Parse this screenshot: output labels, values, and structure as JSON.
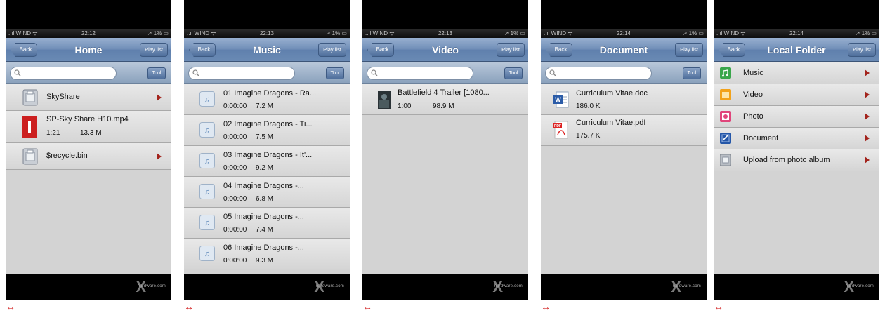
{
  "status": {
    "carrier": "..ıl WIND ᯤ",
    "battery": "↗ 1% ▭"
  },
  "screens": [
    {
      "time": "22:12",
      "title": "Home",
      "back_label": "Back",
      "playlist_label": "Play list",
      "tool_label": "Tool",
      "rows": [
        {
          "name": "SkyShare"
        },
        {
          "name": "SP-Sky Share H10.mp4",
          "duration": "1:21",
          "size": "13.3 M"
        },
        {
          "name": "$recycle.bin"
        }
      ]
    },
    {
      "time": "22:13",
      "title": "Music",
      "back_label": "Back",
      "playlist_label": "Play list",
      "tool_label": "Tool",
      "rows": [
        {
          "name": "01 Imagine Dragons - Ra...",
          "duration": "0:00:00",
          "size": "7.2 M"
        },
        {
          "name": "02 Imagine Dragons - Ti...",
          "duration": "0:00:00",
          "size": "7.5 M"
        },
        {
          "name": "03 Imagine Dragons - It'...",
          "duration": "0:00:00",
          "size": "9.2 M"
        },
        {
          "name": "04 Imagine Dragons -...",
          "duration": "0:00:00",
          "size": "6.8 M"
        },
        {
          "name": "05 Imagine Dragons -...",
          "duration": "0:00:00",
          "size": "7.4 M"
        },
        {
          "name": "06 Imagine Dragons -...",
          "duration": "0:00:00",
          "size": "9.3 M"
        }
      ]
    },
    {
      "time": "22:13",
      "title": "Video",
      "back_label": "Back",
      "playlist_label": "Play list",
      "tool_label": "Tool",
      "rows": [
        {
          "name": "Battlefield 4 Trailer [1080...",
          "duration": "1:00",
          "size": "98.9 M"
        }
      ]
    },
    {
      "time": "22:14",
      "title": "Document",
      "back_label": "Back",
      "playlist_label": "Play list",
      "tool_label": "Tool",
      "rows": [
        {
          "name": "Curriculum Vitae.doc",
          "size": "186.0 K"
        },
        {
          "name": "Curriculum Vitae.pdf",
          "size": "175.7 K"
        }
      ]
    },
    {
      "time": "22:14",
      "title": "Local Folder",
      "back_label": "Back",
      "playlist_label": "Play list",
      "rows": [
        {
          "name": "Music",
          "icon_color": "#3aa64a"
        },
        {
          "name": "Video",
          "icon_color": "#f2a21a"
        },
        {
          "name": "Photo",
          "icon_color": "#e0457b"
        },
        {
          "name": "Document",
          "icon_color": "#2456a8"
        },
        {
          "name": "Upload from photo album",
          "icon_color": "#9a9a9a"
        }
      ]
    }
  ],
  "watermark": "hardware.com",
  "expand_glyph": "↔",
  "colors": {
    "arrow": "#a3241d",
    "nav": "#6f8db7"
  }
}
